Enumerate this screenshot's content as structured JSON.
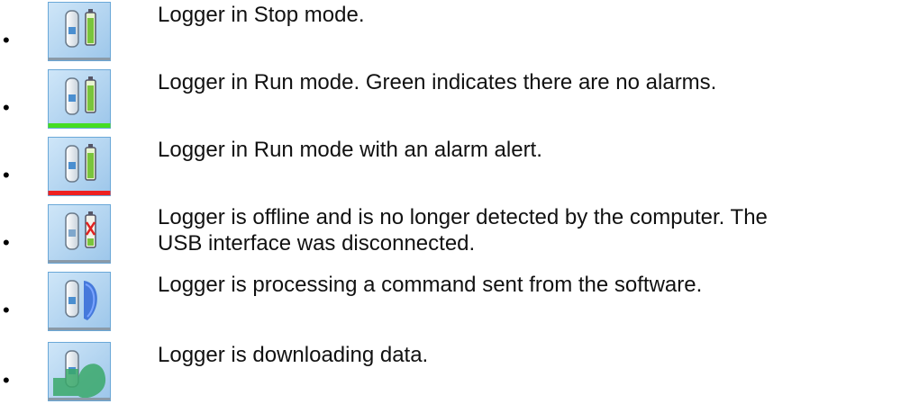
{
  "bullet_glyph": "•",
  "status_items": [
    {
      "icon": "logger-stop-icon",
      "description": "Logger in Stop mode."
    },
    {
      "icon": "logger-run-ok-icon",
      "status_color": "#44dd22",
      "description": "Logger in Run mode. Green indicates there are no alarms."
    },
    {
      "icon": "logger-run-alarm-icon",
      "status_color": "#ee2020",
      "description": "Logger in Run mode with an alarm alert."
    },
    {
      "icon": "logger-offline-icon",
      "description": "Logger is offline and is no longer detected by the computer. The\nUSB interface was disconnected."
    },
    {
      "icon": "logger-processing-icon",
      "description": "Logger is processing a command sent from the software."
    },
    {
      "icon": "logger-downloading-icon",
      "description": "Logger is downloading data."
    }
  ]
}
